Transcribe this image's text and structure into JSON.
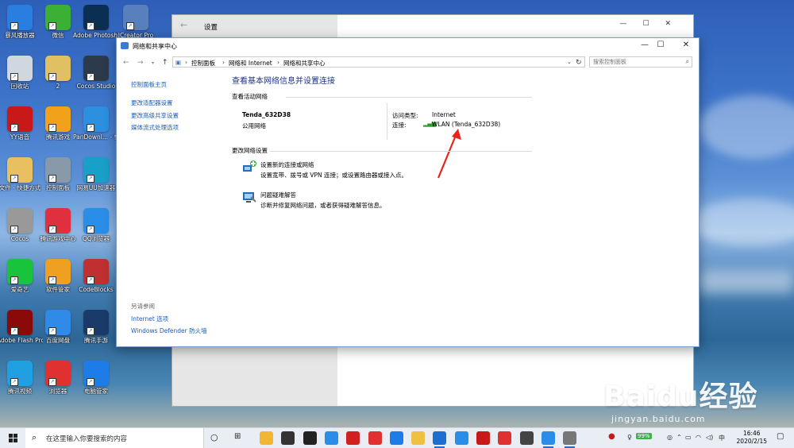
{
  "desktop": {
    "icons": [
      {
        "label": "暴风播放器",
        "color": "#2a7ee0"
      },
      {
        "label": "微信",
        "color": "#3cb035"
      },
      {
        "label": "Adobe Photosh...",
        "color": "#0b2f52"
      },
      {
        "label": "JCreator Pro",
        "color": "#5a7fbd"
      },
      {
        "label": "回收站",
        "color": "#cfd8e0"
      },
      {
        "label": "2",
        "color": "#e0c060"
      },
      {
        "label": "Cocos Studio",
        "color": "#2c3a4c"
      },
      {
        "label": "YY语音",
        "color": "#c81818"
      },
      {
        "label": "腾讯游戏",
        "color": "#f2a21a"
      },
      {
        "label": "PanDownl... - 快捷方式",
        "color": "#2c8fe0"
      },
      {
        "label": "文件 - 快捷方式",
        "color": "#e8c060"
      },
      {
        "label": "控制面板",
        "color": "#8899aa"
      },
      {
        "label": "网易UU加速器",
        "color": "#18a0c8"
      },
      {
        "label": "Cocos",
        "color": "#999999"
      },
      {
        "label": "腾讯游戏中心",
        "color": "#e03040"
      },
      {
        "label": "QQ浏览器",
        "color": "#2a8ee8"
      },
      {
        "label": "爱奇艺",
        "color": "#19c33b"
      },
      {
        "label": "软件管家",
        "color": "#f0a020"
      },
      {
        "label": "CodeBlocks",
        "color": "#c03030"
      },
      {
        "label": "Adobe Flash Professio...",
        "color": "#8a0a0a"
      },
      {
        "label": "百度网盘",
        "color": "#2f8ae8"
      },
      {
        "label": "腾讯手游",
        "color": "#1a3a6a"
      },
      {
        "label": "腾讯视频",
        "color": "#20a0e0"
      },
      {
        "label": "浏览器",
        "color": "#e03030"
      },
      {
        "label": "电脑管家",
        "color": "#1e7ce8"
      }
    ]
  },
  "settings_window": {
    "title": "设置",
    "back_icon": "back-arrow-icon"
  },
  "window": {
    "title": "网络和共享中心",
    "controls": {
      "minimize": "—",
      "maximize": "☐",
      "close": "✕"
    },
    "breadcrumb": [
      "控制面板",
      "网络和 Internet",
      "网络和共享中心"
    ],
    "search_placeholder": "搜索控制面板",
    "left_nav": {
      "home": "控制面板主页",
      "links": [
        "更改适配器设置",
        "更改高级共享设置",
        "媒体流式处理选项"
      ],
      "see_also_title": "另请参阅",
      "see_also": [
        "Internet 选项",
        "Windows Defender 防火墙"
      ]
    },
    "main": {
      "heading": "查看基本网络信息并设置连接",
      "active_networks_title": "查看活动网络",
      "network_name": "Tenda_632D38",
      "network_type": "公用网络",
      "access_type_label": "访问类型:",
      "access_type_value": "Internet",
      "connection_label": "连接:",
      "connection_value": "WLAN (Tenda_632D38)",
      "change_settings_title": "更改网络设置",
      "tasks": [
        {
          "title": "设置新的连接或网络",
          "desc": "设置宽带、拨号或 VPN 连接；或设置路由器或接入点。"
        },
        {
          "title": "问题疑难解答",
          "desc": "诊断并修复网络问题，或者获得疑难解答信息。"
        }
      ]
    }
  },
  "taskbar": {
    "search_placeholder": "在这里输入你要搜索的内容",
    "battery": "99%",
    "time": "16:46",
    "date": "2020/2/15"
  },
  "watermark": {
    "main": "Baidu经验",
    "sub": "jingyan.baidu.com"
  },
  "colors": {
    "link": "#1a5db4",
    "heading": "#1e3287",
    "arrow": "#e8231c"
  }
}
